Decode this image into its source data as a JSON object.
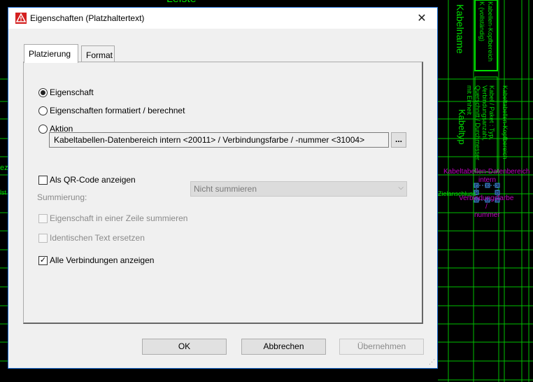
{
  "background": {
    "cad_labels": {
      "top_label": "Leiste",
      "kabelname": "Kabelname",
      "kabelname_vertical_1": "Kabellen-Kopfbereich",
      "kabelname_vertical_2": "K (vollständig)",
      "kabeltyp": "Kabeltyp",
      "mit_einheit": "mit Einheit",
      "querschnitt": "Querschnitt / Durchmesser",
      "verbindungsanzahl": "Verbindungsanzahl,",
      "kabel_paket": "Kabel / Paket : Typ,",
      "kopfbereich_right": "Kabeltabellen-Kopfbereich",
      "magenta_1": "Kabeltabellen-Datenbereich",
      "magenta_2": "intern",
      "magenta_3": "Verbindungsfarbe",
      "magenta_4": "/",
      "magenta_5": "nummer",
      "zielanschluss": "Zielanschluss",
      "left_ez": "ez",
      "left_st": "lst"
    }
  },
  "dialog": {
    "title": "Eigenschaften (Platzhaltertext)",
    "close_glyph": "✕",
    "tabs": [
      {
        "label": "Platzierung",
        "active": true
      },
      {
        "label": "Format",
        "active": false
      }
    ],
    "placement": {
      "radio_eigenschaft": "Eigenschaft",
      "radio_formatiert": "Eigenschaften formatiert / berechnet",
      "radio_aktion": "Aktion",
      "selected_radio": "Eigenschaft",
      "path_value": "Kabeltabellen-Datenbereich intern <20011> / Verbindungsfarbe / -nummer <31004>",
      "browse_label": "...",
      "qr_code_label": "Als QR-Code anzeigen",
      "qr_code_checked": false,
      "summierung_label": "Summierung:",
      "summierung_value": "Nicht summieren",
      "eine_zeile_label": "Eigenschaft in einer Zeile summieren",
      "identisch_label": "Identischen Text ersetzen",
      "alle_verbindungen_label": "Alle Verbindungen anzeigen",
      "alle_verbindungen_checked": true
    },
    "buttons": {
      "ok": "OK",
      "cancel": "Abbrechen",
      "apply": "Übernehmen"
    }
  },
  "colors": {
    "cad_green": "#00e000",
    "cad_magenta": "#c000c0",
    "accent_border": "#1c6fd6"
  }
}
